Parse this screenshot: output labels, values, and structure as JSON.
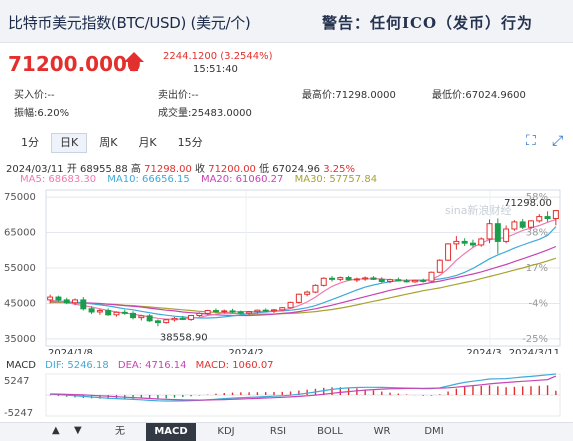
{
  "header": {
    "title": "比特币美元指数(BTC/USD) (美元/个)",
    "warning": "警告：任何ICO（发币）行为"
  },
  "quote": {
    "price": "71200.0000",
    "change": "2244.1200 (3.2544%)",
    "time": "15:51:40"
  },
  "stats": {
    "buy": "买入价:--",
    "sell": "卖出价:--",
    "high": "最高价:71298.0000",
    "low": "最低价:67024.9600",
    "amplitude": "振幅:6.20%",
    "volume": "成交量:25483.0000"
  },
  "tabs": [
    {
      "label": "1分"
    },
    {
      "label": "日K"
    },
    {
      "label": "周K"
    },
    {
      "label": "月K"
    },
    {
      "label": "15分"
    }
  ],
  "active_tab": "日K",
  "toolbar": {
    "expand_icon": "expand-icon",
    "fullscreen_icon": "fullscreen-icon"
  },
  "ohlc": {
    "date": "2024/03/11",
    "open_label": "开",
    "open": "68955.88",
    "high_label": "高",
    "high": "71298.00",
    "close_label": "收",
    "close": "71200.00",
    "low_label": "低",
    "low": "67024.96",
    "change": "3.25%"
  },
  "ma_legend": [
    {
      "label": "MA5: 68683.30",
      "color": "#f07ab0"
    },
    {
      "label": "MA10: 66656.15",
      "color": "#3fa9d9"
    },
    {
      "label": "MA20: 61060.27",
      "color": "#c843b5"
    },
    {
      "label": "MA30: 57757.84",
      "color": "#a9a22e"
    }
  ],
  "watermark": "sina新浪财经",
  "chart_data": {
    "type": "candlestick",
    "y_ticks": [
      "75000",
      "65000",
      "55000",
      "45000",
      "35000"
    ],
    "pct_ticks": [
      "58%",
      "38%",
      "17%",
      "-4%",
      "-25%"
    ],
    "x_labels": [
      "2024/1/8",
      "2024/2",
      "2024/3",
      "2024/3/11"
    ],
    "max_label": "71298.00",
    "min_label": "38558.90",
    "ylim": [
      33000,
      77000
    ],
    "candles": [
      [
        46000,
        47500,
        45000,
        46800
      ],
      [
        46800,
        47200,
        45500,
        46000
      ],
      [
        46000,
        46600,
        44800,
        45200
      ],
      [
        45200,
        46400,
        44500,
        46000
      ],
      [
        46000,
        46800,
        43000,
        43500
      ],
      [
        43500,
        44200,
        42000,
        42600
      ],
      [
        42600,
        43500,
        41800,
        43000
      ],
      [
        43000,
        43600,
        41500,
        41800
      ],
      [
        41800,
        42800,
        41300,
        42500
      ],
      [
        42500,
        43200,
        41800,
        42200
      ],
      [
        42200,
        42800,
        40500,
        41000
      ],
      [
        41000,
        41800,
        40200,
        41500
      ],
      [
        41500,
        42000,
        39800,
        40100
      ],
      [
        40100,
        40500,
        38558.9,
        39600
      ],
      [
        39600,
        40600,
        39300,
        40400
      ],
      [
        40400,
        41200,
        39900,
        40800
      ],
      [
        40800,
        41500,
        40300,
        40500
      ],
      [
        40500,
        41800,
        40100,
        41600
      ],
      [
        41600,
        42500,
        41200,
        42200
      ],
      [
        42200,
        43200,
        41800,
        43000
      ],
      [
        43000,
        43600,
        42300,
        42700
      ],
      [
        42700,
        43300,
        42100,
        42900
      ],
      [
        42900,
        43500,
        42300,
        42600
      ],
      [
        42600,
        43000,
        41900,
        42300
      ],
      [
        42300,
        42900,
        41800,
        42700
      ],
      [
        42700,
        43300,
        42200,
        43100
      ],
      [
        43100,
        43600,
        42500,
        42900
      ],
      [
        42900,
        43400,
        42300,
        43200
      ],
      [
        43200,
        44000,
        42900,
        43800
      ],
      [
        43800,
        45500,
        43600,
        45300
      ],
      [
        45300,
        47800,
        45000,
        47600
      ],
      [
        47600,
        48600,
        47000,
        48200
      ],
      [
        48200,
        50400,
        47900,
        50100
      ],
      [
        50100,
        52400,
        49800,
        52100
      ],
      [
        52100,
        52700,
        51200,
        51800
      ],
      [
        51800,
        52600,
        51300,
        52300
      ],
      [
        52300,
        52800,
        51400,
        51700
      ],
      [
        51700,
        52300,
        51000,
        51900
      ],
      [
        51900,
        52600,
        51400,
        52200
      ],
      [
        52200,
        52700,
        51600,
        51800
      ],
      [
        51800,
        52400,
        50800,
        51200
      ],
      [
        51200,
        52000,
        50700,
        51700
      ],
      [
        51700,
        52300,
        51200,
        51400
      ],
      [
        51400,
        51900,
        50900,
        51100
      ],
      [
        51100,
        51700,
        50800,
        51500
      ],
      [
        51500,
        52000,
        50900,
        51300
      ],
      [
        51300,
        54000,
        51100,
        53800
      ],
      [
        53800,
        57500,
        53600,
        57200
      ],
      [
        57200,
        62000,
        57000,
        61800
      ],
      [
        61800,
        64000,
        60200,
        62500
      ],
      [
        62500,
        63400,
        61200,
        62000
      ],
      [
        62000,
        63000,
        60800,
        61500
      ],
      [
        61500,
        63600,
        61000,
        63200
      ],
      [
        63200,
        68700,
        62000,
        67500
      ],
      [
        67500,
        69000,
        59000,
        62500
      ],
      [
        62500,
        67000,
        62000,
        66000
      ],
      [
        66000,
        68500,
        65500,
        68000
      ],
      [
        68000,
        68800,
        66000,
        66500
      ],
      [
        66500,
        68500,
        66000,
        68300
      ],
      [
        68300,
        70200,
        67800,
        69500
      ],
      [
        69500,
        71000,
        68000,
        68955.88
      ],
      [
        68955.88,
        71298,
        67024.96,
        71200
      ]
    ],
    "ma5": [
      45800,
      45600,
      45200,
      44800,
      44400,
      44000,
      43500,
      43000,
      42600,
      42300,
      42000,
      41600,
      41200,
      40800,
      40600,
      40600,
      40600,
      40800,
      41100,
      41600,
      42000,
      42400,
      42600,
      42700,
      42700,
      42700,
      42800,
      42900,
      43100,
      43600,
      44400,
      45400,
      46800,
      48400,
      49800,
      50800,
      51500,
      51900,
      51900,
      52000,
      51900,
      51700,
      51600,
      51500,
      51400,
      51300,
      51800,
      52900,
      54800,
      57200,
      59100,
      60800,
      62000,
      63000,
      63300,
      63600,
      64600,
      65600,
      66300,
      67000,
      67900,
      68683.3
    ],
    "ma10": [
      45800,
      45700,
      45500,
      45300,
      45100,
      44900,
      44600,
      44300,
      43900,
      43500,
      43200,
      42800,
      42400,
      42000,
      41700,
      41400,
      41200,
      41000,
      40900,
      40900,
      41000,
      41200,
      41500,
      41800,
      42100,
      42400,
      42600,
      42800,
      42900,
      43100,
      43400,
      43800,
      44400,
      45200,
      46100,
      47000,
      47900,
      48800,
      49600,
      50200,
      50700,
      51100,
      51400,
      51500,
      51600,
      51600,
      51700,
      51900,
      52300,
      52900,
      53800,
      54900,
      56200,
      57600,
      58700,
      59600,
      60600,
      61500,
      62300,
      63100,
      64200,
      66656.15
    ],
    "ma20": [
      45500,
      45500,
      45400,
      45300,
      45200,
      45100,
      45000,
      44800,
      44600,
      44400,
      44200,
      44000,
      43700,
      43400,
      43100,
      42900,
      42600,
      42400,
      42200,
      42000,
      41800,
      41700,
      41600,
      41600,
      41600,
      41700,
      41800,
      42000,
      42200,
      42400,
      42700,
      43100,
      43500,
      44000,
      44500,
      45100,
      45700,
      46300,
      46900,
      47500,
      48100,
      48700,
      49200,
      49700,
      50100,
      50500,
      50900,
      51300,
      51800,
      52300,
      52800,
      53300,
      53900,
      54600,
      55300,
      56000,
      56800,
      57600,
      58400,
      59200,
      60100,
      61060.27
    ],
    "ma30": [
      45200,
      45200,
      45200,
      45100,
      45100,
      45000,
      44900,
      44800,
      44700,
      44500,
      44400,
      44200,
      44000,
      43800,
      43600,
      43400,
      43200,
      43000,
      42800,
      42600,
      42500,
      42300,
      42200,
      42100,
      42000,
      42000,
      42000,
      42000,
      42100,
      42200,
      42300,
      42500,
      42700,
      43000,
      43300,
      43700,
      44100,
      44600,
      45100,
      45600,
      46100,
      46600,
      47100,
      47600,
      48100,
      48600,
      49000,
      49400,
      49900,
      50400,
      50900,
      51400,
      52000,
      52600,
      53200,
      53800,
      54400,
      55000,
      55700,
      56300,
      57000,
      57757.84
    ],
    "macd": {
      "labels": {
        "macd": "MACD",
        "dif": "DIF: 5246.18",
        "dea": "DEA: 4716.14",
        "hist": "MACD: 1060.07"
      },
      "ticks": [
        "5247",
        "-5247"
      ],
      "ylim": [
        -5247,
        5247
      ]
    },
    "dif": [
      200,
      100,
      -50,
      -200,
      -350,
      -500,
      -650,
      -800,
      -900,
      -1000,
      -1100,
      -1200,
      -1350,
      -1450,
      -1500,
      -1500,
      -1480,
      -1420,
      -1330,
      -1200,
      -1050,
      -900,
      -780,
      -680,
      -590,
      -500,
      -400,
      -300,
      -190,
      -40,
      200,
      460,
      760,
      1100,
      1400,
      1620,
      1780,
      1880,
      1920,
      1930,
      1900,
      1850,
      1790,
      1720,
      1650,
      1580,
      1600,
      1800,
      2250,
      2750,
      3150,
      3450,
      3700,
      4000,
      4050,
      4100,
      4300,
      4500,
      4650,
      4850,
      5050,
      5246.18
    ],
    "dea": [
      250,
      220,
      170,
      100,
      20,
      -80,
      -190,
      -310,
      -420,
      -540,
      -650,
      -760,
      -880,
      -990,
      -1080,
      -1160,
      -1220,
      -1260,
      -1270,
      -1250,
      -1210,
      -1150,
      -1080,
      -1010,
      -930,
      -850,
      -760,
      -670,
      -580,
      -480,
      -350,
      -200,
      -20,
      200,
      430,
      650,
      860,
      1050,
      1220,
      1360,
      1470,
      1550,
      1610,
      1650,
      1670,
      1680,
      1690,
      1710,
      1810,
      1960,
      2150,
      2350,
      2560,
      2780,
      2970,
      3130,
      3280,
      3420,
      3560,
      3700,
      3840,
      4716.14
    ]
  },
  "bottom_bar": {
    "tabs": [
      {
        "label": "无"
      },
      {
        "label": "MACD"
      },
      {
        "label": "KDJ"
      },
      {
        "label": "RSI"
      },
      {
        "label": "BOLL"
      },
      {
        "label": "WR"
      },
      {
        "label": "DMI"
      }
    ],
    "active": "MACD",
    "arrows": [
      "▲",
      "▼"
    ]
  }
}
